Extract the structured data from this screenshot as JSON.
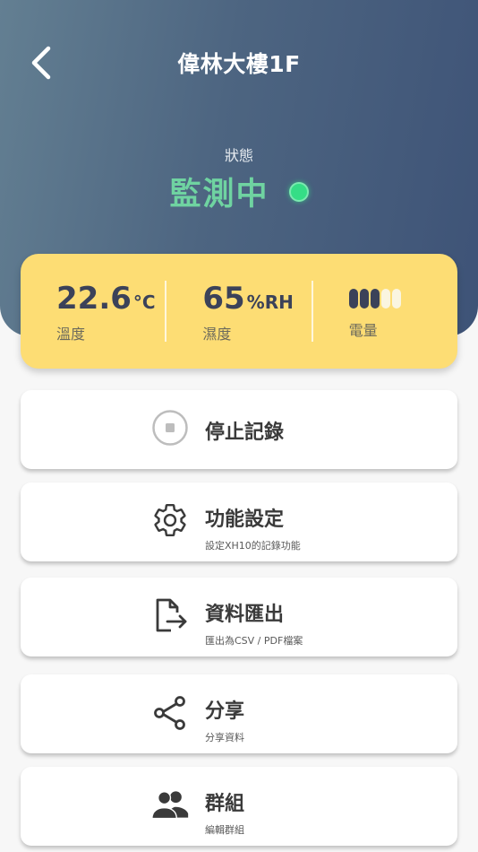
{
  "header": {
    "title": "偉林大樓1F",
    "status_label": "狀態",
    "status_value": "監測中",
    "status_color": "#35dd86"
  },
  "stats": {
    "temperature": {
      "value": "22.6",
      "unit": "°C",
      "label": "溫度"
    },
    "humidity": {
      "value": "65",
      "unit": "%RH",
      "label": "濕度"
    },
    "battery": {
      "label": "電量",
      "level_segments": 3,
      "total_segments": 5
    }
  },
  "menu": [
    {
      "title": "停止記錄",
      "subtitle": "",
      "icon": "stop-circle-icon"
    },
    {
      "title": "功能設定",
      "subtitle": "設定XH10的記錄功能",
      "icon": "gear-icon"
    },
    {
      "title": "資料匯出",
      "subtitle": "匯出為CSV / PDF檔案",
      "icon": "file-export-icon"
    },
    {
      "title": "分享",
      "subtitle": "分享資料",
      "icon": "share-icon"
    },
    {
      "title": "群組",
      "subtitle": "編輯群組",
      "icon": "group-icon"
    }
  ],
  "colors": {
    "header_gradient_start": "#637f92",
    "header_gradient_end": "#3e5377",
    "stats_card": "#fddd74",
    "status_text": "#6fd3a1"
  }
}
